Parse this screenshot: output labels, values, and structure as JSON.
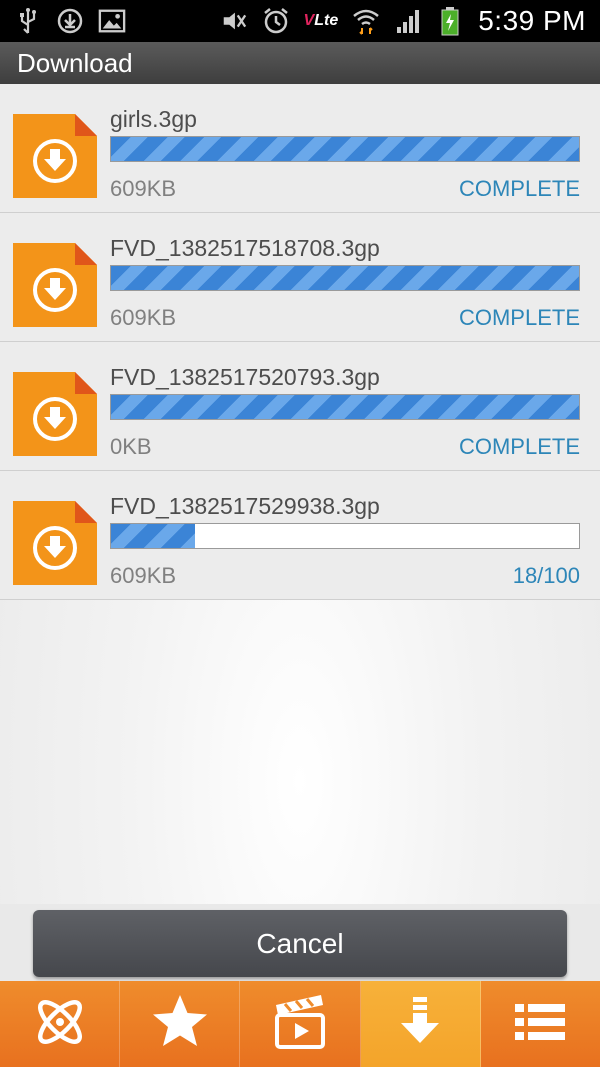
{
  "status_bar": {
    "time": "5:39 PM",
    "volte_text": "Lte",
    "volte_prefix": "V"
  },
  "title": "Download",
  "downloads": [
    {
      "filename": "girls.3gp",
      "size": "609KB",
      "status": "COMPLETE",
      "progress": 1.0
    },
    {
      "filename": "FVD_1382517518708.3gp",
      "size": "609KB",
      "status": "COMPLETE",
      "progress": 1.0
    },
    {
      "filename": "FVD_1382517520793.3gp",
      "size": "0KB",
      "status": "COMPLETE",
      "progress": 1.0
    },
    {
      "filename": "FVD_1382517529938.3gp",
      "size": "609KB",
      "status": "18/100",
      "progress": 0.18
    }
  ],
  "cancel_label": "Cancel",
  "nav": {
    "items": [
      {
        "icon": "atom-icon",
        "active": false
      },
      {
        "icon": "star-icon",
        "active": false
      },
      {
        "icon": "clapperboard-icon",
        "active": false
      },
      {
        "icon": "download-arrow-icon",
        "active": true
      },
      {
        "icon": "list-icon",
        "active": false
      }
    ]
  },
  "colors": {
    "accent_orange": "#ec7f26",
    "active_tab": "#f5a82e",
    "progress_blue": "#3b84d6",
    "status_blue": "#2d86b8"
  }
}
